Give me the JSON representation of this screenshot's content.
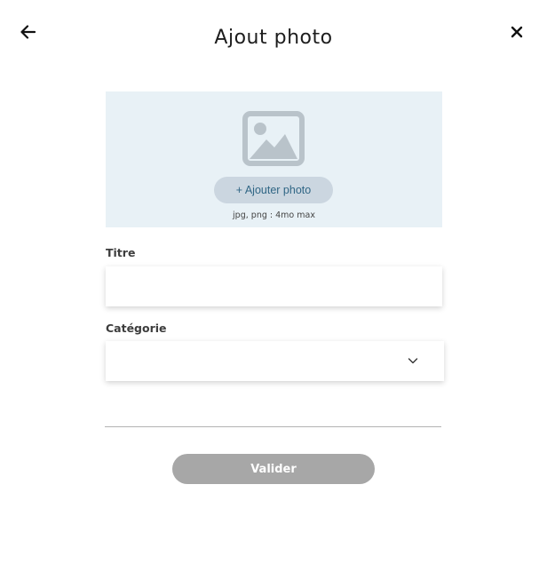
{
  "header": {
    "title": "Ajout photo",
    "back_icon": "arrow-left-icon",
    "close_icon": "close-icon"
  },
  "upload": {
    "icon": "picture-icon",
    "button_label": "+ Ajouter photo",
    "hint": "jpg, png : 4mo max"
  },
  "form": {
    "title_label": "Titre",
    "title_value": "",
    "category_label": "Catégorie",
    "category_value": "",
    "category_icon": "chevron-down-icon"
  },
  "footer": {
    "submit_label": "Valider"
  },
  "colors": {
    "upload_bg": "#e8f1f6",
    "upload_button_bg": "#cbd6e0",
    "upload_button_text": "#306685",
    "submit_disabled_bg": "#a7a7a7",
    "icon_gray": "#b9c3ca"
  }
}
